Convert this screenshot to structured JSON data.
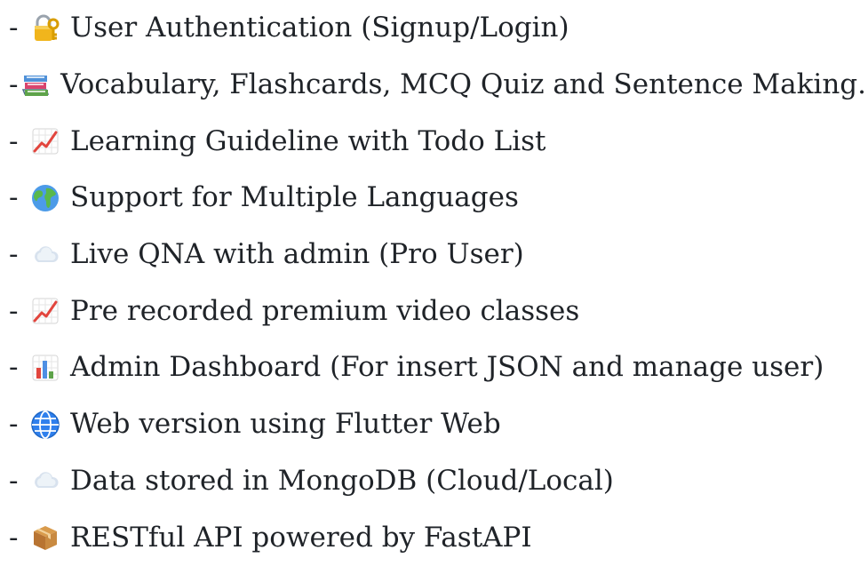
{
  "features": [
    {
      "dash": "-",
      "icon": "lock-key-icon",
      "label": "User Authentication (Signup/Login)"
    },
    {
      "dash": "-",
      "icon": "books-icon",
      "label": "Vocabulary, Flashcards, MCQ Quiz and Sentence Making."
    },
    {
      "dash": "-",
      "icon": "chart-increasing-icon",
      "label": "Learning Guideline with Todo List"
    },
    {
      "dash": "-",
      "icon": "globe-icon",
      "label": "Support for Multiple Languages"
    },
    {
      "dash": "-",
      "icon": "cloud-icon",
      "label": "Live QNA with admin (Pro User)"
    },
    {
      "dash": "-",
      "icon": "chart-increasing-icon",
      "label": "Pre recorded premium video classes"
    },
    {
      "dash": "-",
      "icon": "bar-chart-icon",
      "label": "Admin Dashboard (For insert JSON and manage user)"
    },
    {
      "dash": "-",
      "icon": "globe-meridians-icon",
      "label": "Web version using Flutter Web"
    },
    {
      "dash": "-",
      "icon": "cloud-icon",
      "label": "Data stored in MongoDB (Cloud/Local)"
    },
    {
      "dash": "-",
      "icon": "package-icon",
      "label": "RESTful API powered by FastAPI"
    }
  ]
}
